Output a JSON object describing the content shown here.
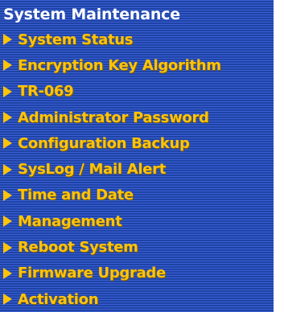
{
  "menu": {
    "title": "System Maintenance",
    "arrow_icon": "triangle-right-icon",
    "colors": {
      "background": "#2a4fb8",
      "title_text": "#ffffff",
      "item_text": "#ffc40a"
    },
    "items": [
      {
        "label": "System Status"
      },
      {
        "label": "Encryption Key Algorithm"
      },
      {
        "label": "TR-069"
      },
      {
        "label": "Administrator Password"
      },
      {
        "label": "Configuration Backup"
      },
      {
        "label": "SysLog / Mail Alert"
      },
      {
        "label": "Time and Date"
      },
      {
        "label": "Management"
      },
      {
        "label": "Reboot System"
      },
      {
        "label": "Firmware Upgrade"
      },
      {
        "label": "Activation"
      }
    ]
  }
}
